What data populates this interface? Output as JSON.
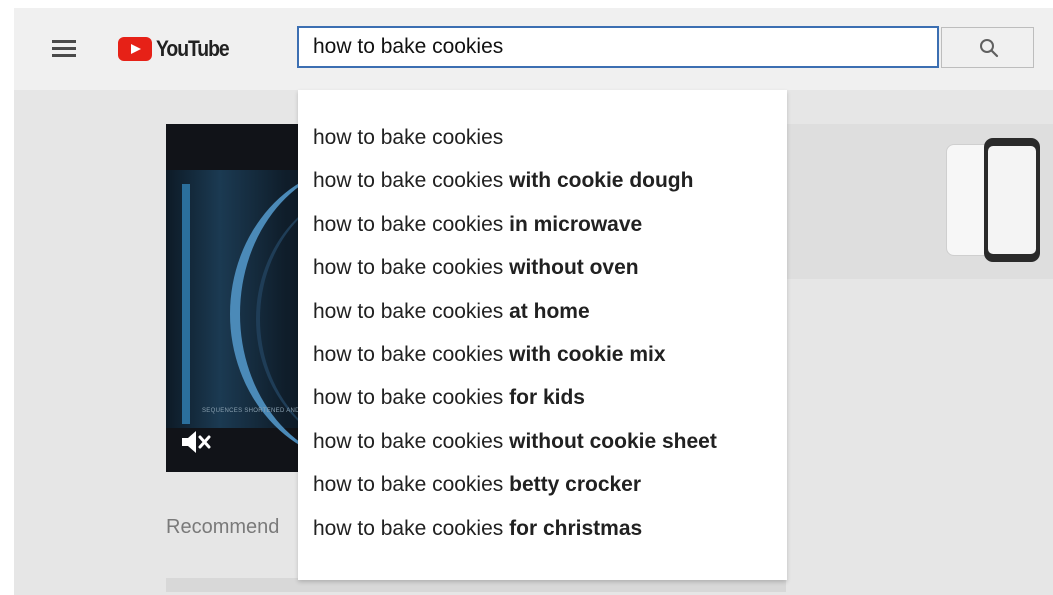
{
  "header": {
    "logo_text": "YouTube",
    "search_value": "how to bake cookies"
  },
  "player": {
    "caption": "SEQUENCES SHORTENED AND SIMULATED"
  },
  "page": {
    "recommended_label": "Recommend"
  },
  "suggestions": [
    {
      "query": "how to bake cookies",
      "completion": ""
    },
    {
      "query": "how to bake cookies",
      "completion": " with cookie dough"
    },
    {
      "query": "how to bake cookies",
      "completion": " in microwave"
    },
    {
      "query": "how to bake cookies",
      "completion": " without oven"
    },
    {
      "query": "how to bake cookies",
      "completion": " at home"
    },
    {
      "query": "how to bake cookies",
      "completion": " with cookie mix"
    },
    {
      "query": "how to bake cookies",
      "completion": " for kids"
    },
    {
      "query": "how to bake cookies",
      "completion": " without cookie sheet"
    },
    {
      "query": "how to bake cookies",
      "completion": " betty crocker"
    },
    {
      "query": "how to bake cookies",
      "completion": " for christmas"
    }
  ],
  "colors": {
    "brand_red": "#e62117",
    "search_border": "#3c6fb2",
    "overlay_gray": "#e6e6e6"
  },
  "icons": [
    "hamburger-menu-icon",
    "youtube-play-icon",
    "search-icon",
    "mute-icon"
  ]
}
